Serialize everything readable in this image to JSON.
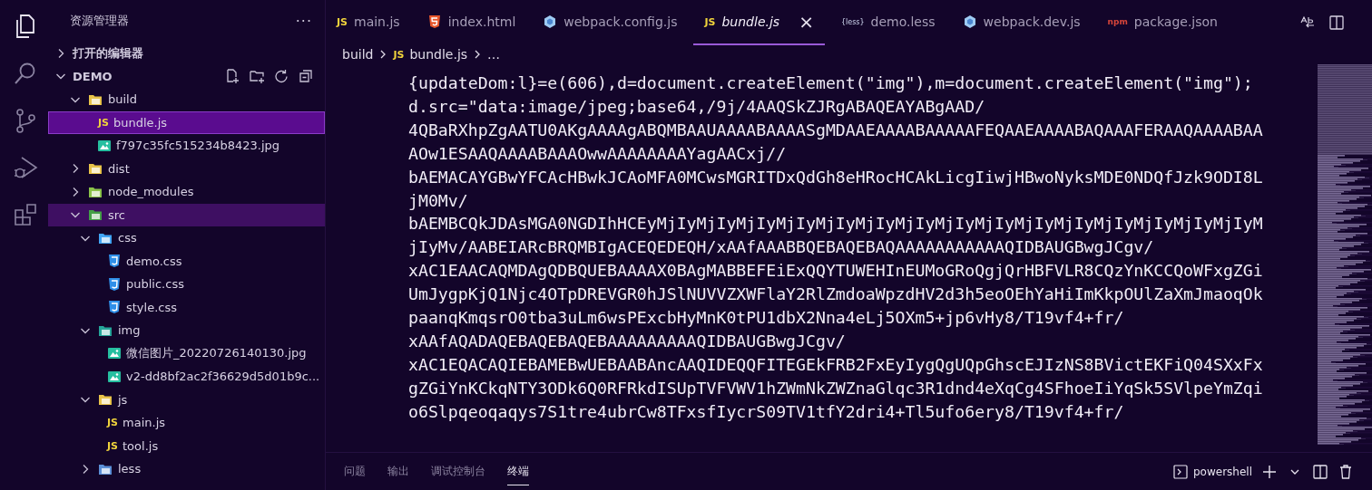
{
  "activity_bar": [
    {
      "kind": "explorer",
      "selected": true
    },
    {
      "kind": "search",
      "selected": false
    },
    {
      "kind": "source-control",
      "selected": false
    },
    {
      "kind": "debug",
      "selected": false
    },
    {
      "kind": "extensions",
      "selected": false
    }
  ],
  "sidebar": {
    "title": "资源管理器",
    "more": "···",
    "open_editors": {
      "label": "打开的编辑器",
      "expanded": false
    },
    "workspace": {
      "label": "DEMO",
      "expanded": true,
      "tree": [
        {
          "name": "build",
          "kind": "folder",
          "color": "#e8c34a",
          "expanded": true,
          "selected": false,
          "highlighted": false,
          "children": [
            {
              "name": "bundle.js",
              "kind": "js",
              "icon_text": "JS",
              "selected": true,
              "highlighted": false
            },
            {
              "name": "f797c35fc515234b8423.jpg",
              "kind": "image",
              "selected": false,
              "highlighted": false
            }
          ]
        },
        {
          "name": "dist",
          "kind": "folder",
          "color": "#e8c34a",
          "expanded": false,
          "selected": false,
          "highlighted": false
        },
        {
          "name": "node_modules",
          "kind": "folder",
          "color": "#8bc34a",
          "expanded": false,
          "selected": false,
          "highlighted": false
        },
        {
          "name": "src",
          "kind": "folder",
          "color": "#43a047",
          "expanded": true,
          "selected": false,
          "highlighted": true,
          "children": [
            {
              "name": "css",
              "kind": "folder",
              "color": "#42a5f5",
              "expanded": true,
              "selected": false,
              "highlighted": false,
              "children": [
                {
                  "name": "demo.css",
                  "kind": "css",
                  "selected": false,
                  "highlighted": false
                },
                {
                  "name": "public.css",
                  "kind": "css",
                  "selected": false,
                  "highlighted": false
                },
                {
                  "name": "style.css",
                  "kind": "css",
                  "selected": false,
                  "highlighted": false
                }
              ]
            },
            {
              "name": "img",
              "kind": "folder",
              "color": "#26a69a",
              "expanded": true,
              "selected": false,
              "highlighted": false,
              "children": [
                {
                  "name": "微信图片_20220726140130.jpg",
                  "kind": "image",
                  "selected": false,
                  "highlighted": false
                },
                {
                  "name": "v2-dd8bf2ac2f36629d5d01b9c...",
                  "kind": "image",
                  "selected": false,
                  "highlighted": false
                }
              ]
            },
            {
              "name": "js",
              "kind": "folder",
              "color": "#e8c34a",
              "expanded": true,
              "selected": false,
              "highlighted": false,
              "children": [
                {
                  "name": "main.js",
                  "kind": "js",
                  "icon_text": "JS",
                  "selected": false,
                  "highlighted": false
                },
                {
                  "name": "tool.js",
                  "kind": "js",
                  "icon_text": "JS",
                  "selected": false,
                  "highlighted": false
                }
              ]
            },
            {
              "name": "less",
              "kind": "folder",
              "color": "#5c8fd6",
              "expanded": false,
              "selected": false,
              "highlighted": false
            }
          ]
        }
      ]
    }
  },
  "tabs": [
    {
      "label": "main.js",
      "kind": "js",
      "icon_text": "JS",
      "selected": false,
      "italic": false
    },
    {
      "label": "index.html",
      "kind": "html",
      "selected": false,
      "italic": false
    },
    {
      "label": "webpack.config.js",
      "kind": "webpack",
      "selected": false,
      "italic": false
    },
    {
      "label": "bundle.js",
      "kind": "js",
      "icon_text": "JS",
      "selected": true,
      "italic": true,
      "close": "×"
    },
    {
      "label": "demo.less",
      "kind": "less",
      "icon_text": "{less}",
      "selected": false,
      "italic": false
    },
    {
      "label": "webpack.dev.js",
      "kind": "webpack",
      "selected": false,
      "italic": false
    },
    {
      "label": "package.json",
      "kind": "npm",
      "icon_text": "npm",
      "selected": false,
      "italic": false
    }
  ],
  "breadcrumb": [
    {
      "label": "build"
    },
    {
      "label": "bundle.js",
      "kind": "js",
      "icon_text": "JS"
    },
    {
      "label": "…"
    }
  ],
  "code_lines": [
    "{updateDom:l}=e(606),d=document.createElement(\"img\"),m=document.createElement(\"img\");",
    "d.src=\"data:image/jpeg;base64,/9j/4AAQSkZJRgABAQEAYABgAAD/",
    "4QBaRXhpZgAATU0AKgAAAAgABQMBAAUAAAABAAAASgMDAAEAAAABAAAAAFEQAAEAAAABAQAAAFERAAQAAAABAA",
    "AOw1ESAAQAAAABAAAOwwAAAAAAAAYagAACxj//",
    "bAEMACAYGBwYFCAcHBwkJCAoMFA0MCwsMGRITDxQdGh8eHRocHCAkLicgIiwjHBwoNyksMDE0NDQfJzk9ODI8L",
    "jM0Mv/",
    "bAEMBCQkJDAsMGA0NGDIhHCEyMjIyMjIyMjIyMjIyMjIyMjIyMjIyMjIyMjIyMjIyMjIyMjIyMjIyMjIyMjIyM",
    "jIyMv/AABEIARcBRQMBIgACEQEDEQH/xAAfAAABBQEBAQEBAQAAAAAAAAAAAQIDBAUGBwgJCgv/",
    "xAC1EAACAQMDAgQDBQUEBAAAAX0BAgMABBEFEiExQQYTUWEHInEUMoGRoQgjQrHBFVLR8CQzYnKCCQoWFxgZGi",
    "UmJygpKjQ1Njc4OTpDREVGR0hJSlNUVVZXWFlaY2RlZmdoaWpzdHV2d3h5eoOEhYaHiImKkpOUlZaXmJmaoqOk",
    "paanqKmqsrO0tba3uLm6wsPExcbHyMnK0tPU1dbX2Nna4eLj5OXm5+jp6vHy8/T19vf4+fr/",
    "xAAfAQADAQEBAQEBAQEBAAAAAAAAAQIDBAUGBwgJCgv/",
    "xAC1EQACAQIEBAMEBwUEBAABAncAAQIDEQQFITEGEkFRB2FxEyIygQgUQpGhscEJIzNS8BVictEKFiQ04SXxFx",
    "gZGiYnKCkqNTY3ODk6Q0RFRkdISUpTVFVWV1hZWmNkZWZnaGlqc3R1dnd4eXqCg4SFhoeIiYqSk5SVlpeYmZqi",
    "o6Slpqeoqaqys7S1tre4ubrCw8TFxsfIycrS09TV1tfY2dri4+Tl5ufo6ery8/T19vf4+fr/"
  ],
  "panel": {
    "tabs": [
      {
        "label": "问题",
        "selected": false
      },
      {
        "label": "输出",
        "selected": false
      },
      {
        "label": "调试控制台",
        "selected": false
      },
      {
        "label": "终端",
        "selected": true
      }
    ],
    "terminal": "powershell"
  }
}
